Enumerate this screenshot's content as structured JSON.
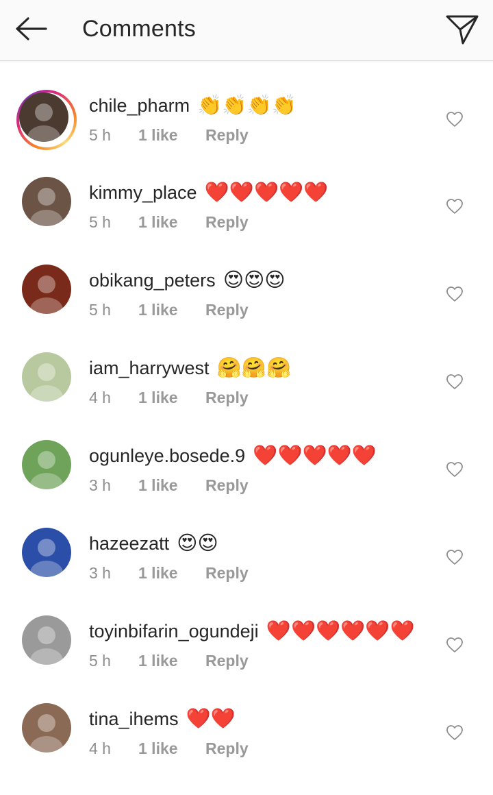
{
  "header": {
    "title": "Comments",
    "back_icon": "arrow-left-icon",
    "send_icon": "paper-plane-icon"
  },
  "colors": {
    "header_bg": "#fafafa",
    "text_primary": "#262626",
    "text_secondary": "#8e8e8e",
    "emoji_heart": "#e0242b",
    "story_ring_start": "#f58529",
    "story_ring_end": "#dd2a7b"
  },
  "comments": [
    {
      "username": "chile_pharm",
      "text": "👏👏👏👏",
      "time": "5 h",
      "likes": "1 like",
      "reply": "Reply",
      "story": true,
      "avatar_color": "#4a3a30"
    },
    {
      "username": "kimmy_place",
      "text": "❤️❤️❤️❤️❤️",
      "time": "5 h",
      "likes": "1 like",
      "reply": "Reply",
      "story": false,
      "avatar_color": "#6b5446"
    },
    {
      "username": "obikang_peters",
      "text": "😍😍😍",
      "time": "5 h",
      "likes": "1 like",
      "reply": "Reply",
      "story": false,
      "avatar_color": "#7a2a1a"
    },
    {
      "username": "iam_harrywest",
      "text": "🤗🤗🤗",
      "time": "4 h",
      "likes": "1 like",
      "reply": "Reply",
      "story": false,
      "avatar_color": "#b8c9a0"
    },
    {
      "username": "ogunleye.bosede.9",
      "text": "❤️❤️❤️❤️❤️",
      "time": "3 h",
      "likes": "1 like",
      "reply": "Reply",
      "story": false,
      "avatar_color": "#6fa35a"
    },
    {
      "username": "hazeezatt",
      "text": "😍😍",
      "time": "3 h",
      "likes": "1 like",
      "reply": "Reply",
      "story": false,
      "avatar_color": "#2b4fa8"
    },
    {
      "username": "toyinbifarin_ogundeji",
      "text": "❤️❤️❤️❤️❤️❤️",
      "time": "5 h",
      "likes": "1 like",
      "reply": "Reply",
      "story": false,
      "avatar_color": "#9a9a9a"
    },
    {
      "username": "tina_ihems",
      "text": "❤️❤️",
      "time": "4 h",
      "likes": "1 like",
      "reply": "Reply",
      "story": false,
      "avatar_color": "#8a6a55"
    }
  ]
}
